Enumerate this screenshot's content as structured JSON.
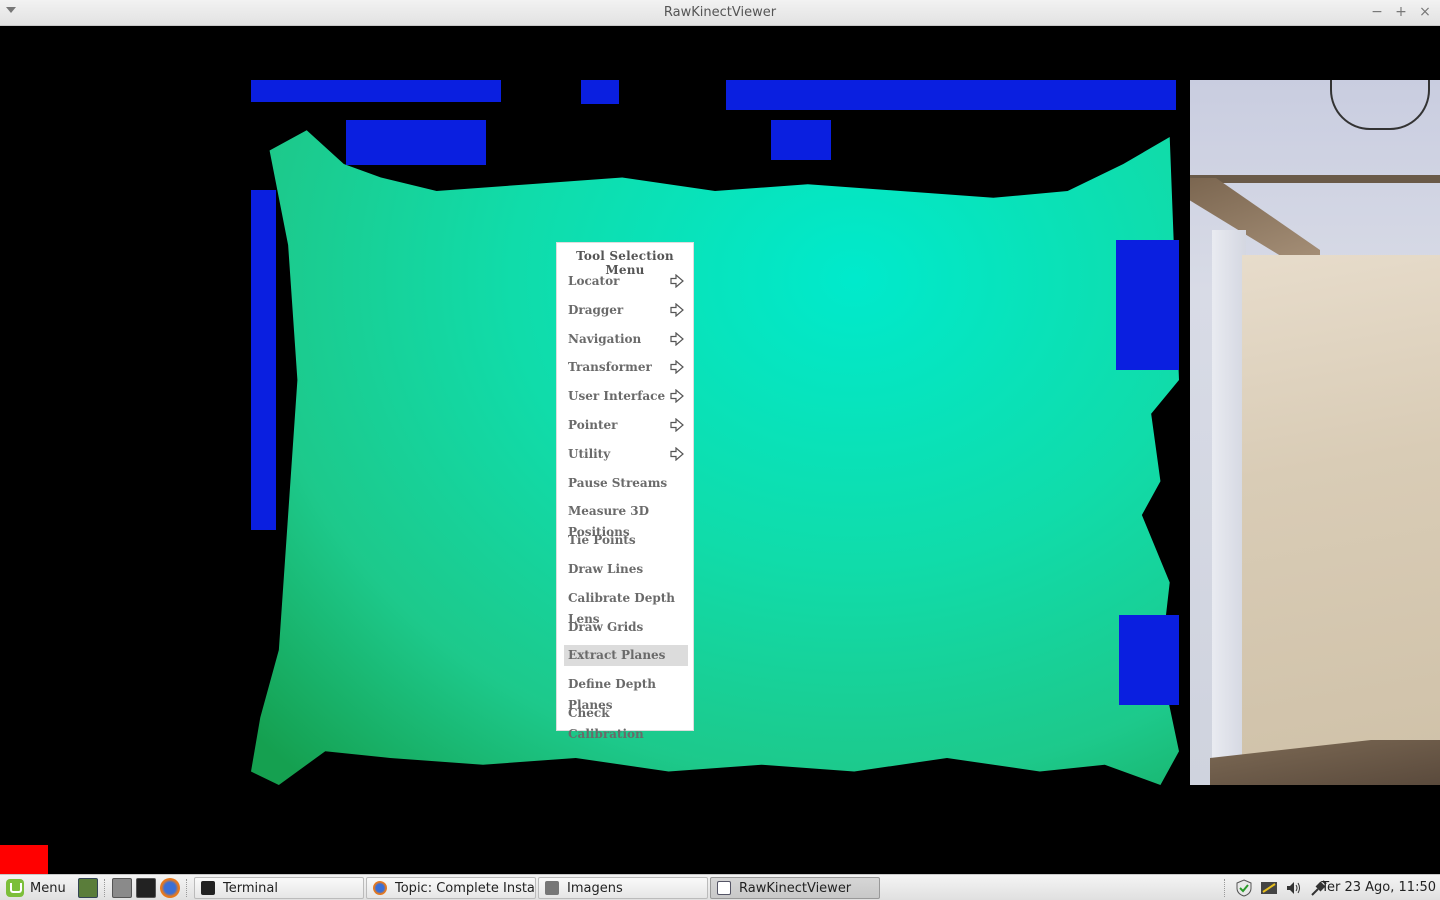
{
  "window": {
    "title": "RawKinectViewer",
    "buttons": {
      "minimize": "−",
      "maximize": "+",
      "close": "×"
    }
  },
  "tool_menu": {
    "title": "Tool Selection Menu",
    "items": [
      {
        "label": "Locator",
        "submenu": true
      },
      {
        "label": "Dragger",
        "submenu": true
      },
      {
        "label": "Navigation",
        "submenu": true
      },
      {
        "label": "Transformer",
        "submenu": true
      },
      {
        "label": "User Interface",
        "submenu": true
      },
      {
        "label": "Pointer",
        "submenu": true
      },
      {
        "label": "Utility",
        "submenu": true
      },
      {
        "label": "Pause Streams",
        "submenu": false
      },
      {
        "label": "Measure 3D Positions",
        "submenu": false
      },
      {
        "label": "Tie Points",
        "submenu": false
      },
      {
        "label": "Draw Lines",
        "submenu": false
      },
      {
        "label": "Calibrate Depth Lens",
        "submenu": false
      },
      {
        "label": "Draw Grids",
        "submenu": false
      },
      {
        "label": "Extract Planes",
        "submenu": false,
        "selected": true
      },
      {
        "label": "Define Depth Planes",
        "submenu": false
      },
      {
        "label": "Check Calibration",
        "submenu": false
      }
    ]
  },
  "taskbar": {
    "menu_label": "Menu",
    "tasks": [
      {
        "label": "Terminal",
        "icon": "terminal-icon",
        "active": false
      },
      {
        "label": "Topic: Complete Insta...",
        "icon": "firefox-icon",
        "active": false
      },
      {
        "label": "Imagens",
        "icon": "image-viewer-icon",
        "active": false
      },
      {
        "label": "RawKinectViewer",
        "icon": "window-icon",
        "active": true
      }
    ],
    "clock": "Ter 23 Ago, 11:50"
  },
  "colors": {
    "depth_near": "#00eacc",
    "depth_far": "#0a1fe0",
    "indicator": "#ff0000"
  }
}
